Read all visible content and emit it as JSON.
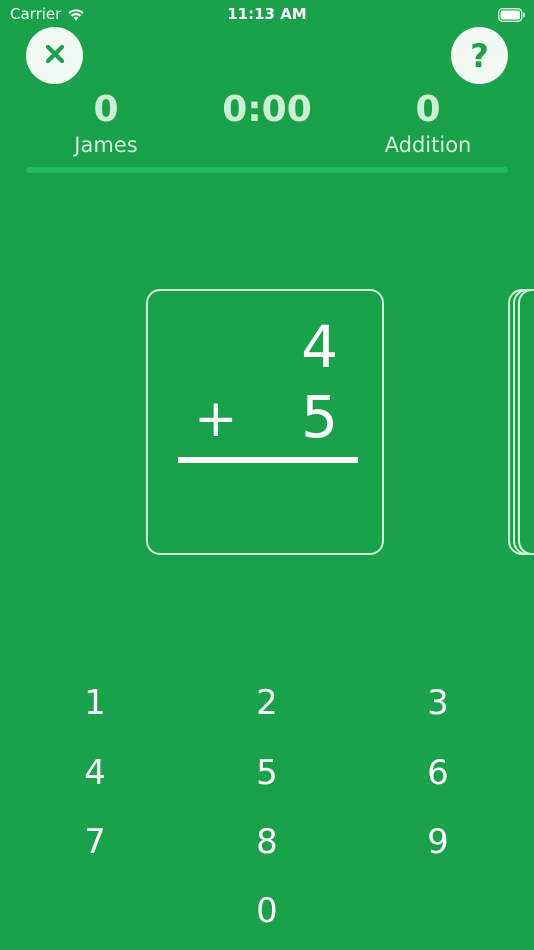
{
  "status_bar": {
    "carrier": "Carrier",
    "time": "11:13 AM"
  },
  "header": {
    "close_icon": "close-icon",
    "help_label": "?",
    "player": {
      "score": "0",
      "name": "James"
    },
    "timer": "0:00",
    "mode": {
      "count": "0",
      "name": "Addition"
    }
  },
  "card": {
    "top_operand": "4",
    "operator": "+",
    "bottom_operand": "5"
  },
  "keypad": {
    "keys": [
      "1",
      "2",
      "3",
      "4",
      "5",
      "6",
      "7",
      "8",
      "9",
      "0"
    ]
  },
  "colors": {
    "background": "#19a249",
    "button_bg": "#f1fbf3",
    "progress_track": "#1fbd56"
  }
}
